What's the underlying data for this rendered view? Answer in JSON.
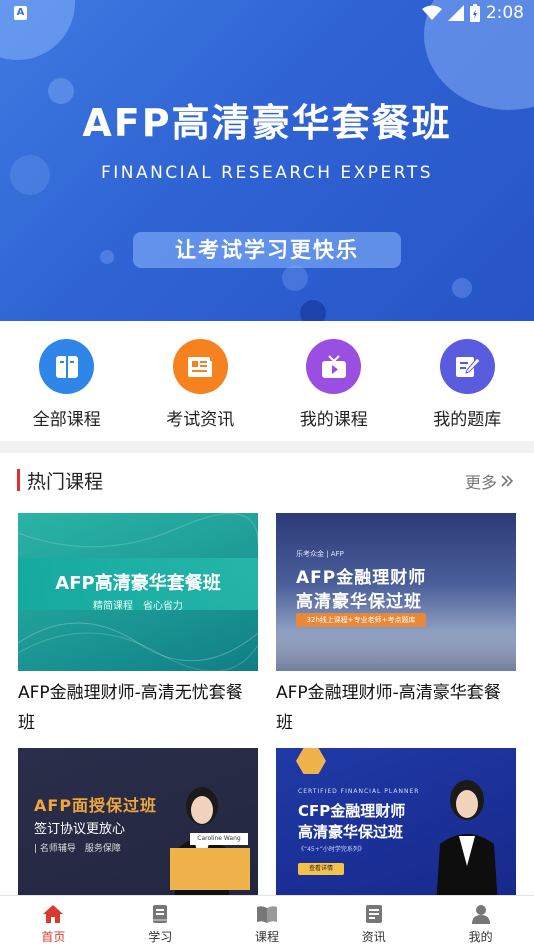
{
  "status_bar": {
    "time": "2:08",
    "notification_icon": "A"
  },
  "banner": {
    "title": "AFP高清豪华套餐班",
    "subtitle": "FINANCIAL RESEARCH EXPERTS",
    "slogan": "让考试学习更快乐"
  },
  "quick_nav": {
    "items": [
      {
        "label": "全部课程",
        "icon": "book-icon",
        "color": "#2f86e8"
      },
      {
        "label": "考试资讯",
        "icon": "news-icon",
        "color": "#f5821f"
      },
      {
        "label": "我的课程",
        "icon": "tv-icon",
        "color": "#9b4fe0"
      },
      {
        "label": "我的题库",
        "icon": "edit-icon",
        "color": "#5a5ce0"
      }
    ]
  },
  "hot_courses": {
    "title": "热门课程",
    "more_label": "更多",
    "courses": [
      {
        "title": "AFP金融理财师-高清无忧套餐班",
        "image": {
          "title": "AFP高清豪华套餐班",
          "subtitle": "精简课程　省心省力"
        }
      },
      {
        "title": "AFP金融理财师-高清豪华套餐班",
        "image": {
          "tag": "乐考众金 | AFP",
          "line1": "AFP金融理财师",
          "line2": "高清豪华保过班",
          "pill": "32h线上课程+专业老师+考点题库"
        }
      },
      {
        "title": "",
        "image": {
          "title": "AFP面授保过班",
          "subtitle": "签订协议更放心",
          "points": "| 名师辅导　服务保障",
          "name": "Caroline Wang"
        }
      },
      {
        "title": "",
        "image": {
          "tag": "CERTIFIED FINANCIAL PLANNER",
          "line1": "CFP金融理财师",
          "line2": "高清豪华保过班",
          "note": "《“45+”小时学完系列》",
          "button": "查看详情"
        }
      }
    ]
  },
  "tab_bar": {
    "tabs": [
      {
        "label": "首页",
        "icon": "home-icon",
        "active": true
      },
      {
        "label": "学习",
        "icon": "study-icon",
        "active": false
      },
      {
        "label": "课程",
        "icon": "course-icon",
        "active": false
      },
      {
        "label": "资讯",
        "icon": "news-icon",
        "active": false
      },
      {
        "label": "我的",
        "icon": "profile-icon",
        "active": false
      }
    ]
  },
  "colors": {
    "accent": "#d93a2d",
    "banner": "#2f63d3"
  }
}
